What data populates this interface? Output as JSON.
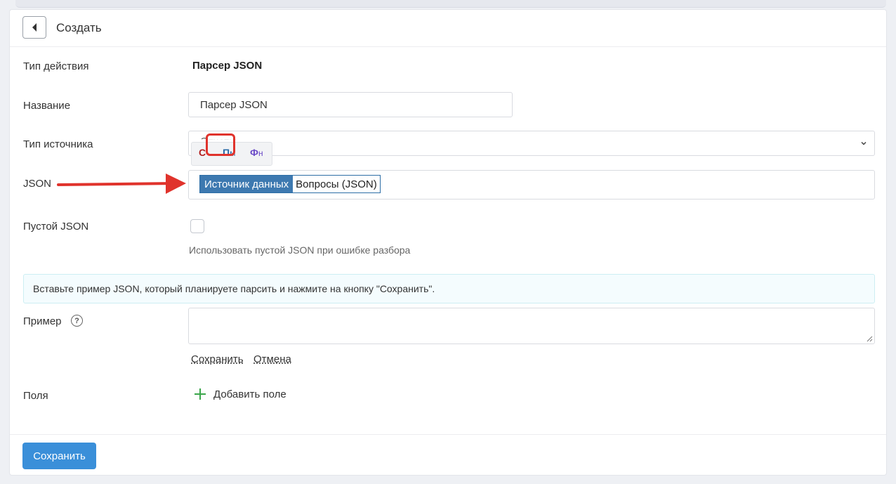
{
  "header": {
    "title": "Создать"
  },
  "form": {
    "action_type": {
      "label": "Тип действия",
      "value": "Парсер JSON"
    },
    "name": {
      "label": "Название",
      "value": "Парсер JSON"
    },
    "source_type": {
      "label": "Тип источника",
      "value": "Отчеты"
    },
    "variable_popup": {
      "c": {
        "main": "С",
        "sub": ""
      },
      "pm": {
        "main": "П",
        "sub": "м"
      },
      "fn": {
        "main": "Ф",
        "sub": "н"
      }
    },
    "json": {
      "label": "JSON",
      "token_source": "Источник данных",
      "token_name": "Вопросы (JSON)"
    },
    "empty_json": {
      "label": "Пустой JSON",
      "checked": false,
      "hint": "Использовать пустой JSON при ошибке разбора"
    },
    "info_text": "Вставьте пример JSON, который планируете парсить и нажмите на кнопку \"Сохранить\".",
    "example": {
      "label": "Пример",
      "help_icon": "?",
      "value": "",
      "save_link": "Сохранить",
      "cancel_link": "Отмена"
    },
    "fields": {
      "label": "Поля",
      "add_label": "Добавить поле"
    }
  },
  "footer": {
    "save_label": "Сохранить"
  },
  "colors": {
    "primary": "#3a8fd9",
    "token_bg": "#3d79b0",
    "highlight": "#e0332c",
    "add_icon": "#3aa64a"
  }
}
